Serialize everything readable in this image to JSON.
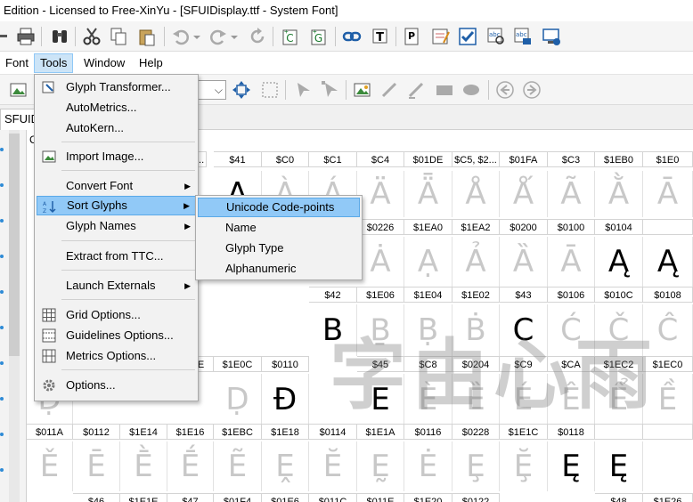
{
  "window": {
    "title": "Edition - Licensed to Free-XinYu - [SFUIDisplay.ttf - System Font]"
  },
  "menubar": {
    "items": [
      "Font",
      "Tools",
      "Window",
      "Help"
    ],
    "active": "Tools"
  },
  "document_tab": {
    "label": "SFUIDis"
  },
  "grid_partial_header": "C",
  "tools_menu": {
    "items": [
      {
        "label": "Glyph Transformer...",
        "icon": "glyph-transformer-icon"
      },
      {
        "label": "AutoMetrics..."
      },
      {
        "label": "AutoKern..."
      },
      {
        "label": "Import Image...",
        "icon": "image-icon"
      },
      {
        "label": "Convert Font",
        "submenu": true
      },
      {
        "label": "Sort Glyphs",
        "submenu": true,
        "icon": "sort-az-icon"
      },
      {
        "label": "Glyph Names",
        "submenu": true
      },
      {
        "label": "Extract from TTC..."
      },
      {
        "label": "Launch Externals",
        "submenu": true
      },
      {
        "label": "Grid Options...",
        "icon": "grid-icon"
      },
      {
        "label": "Guidelines Options...",
        "icon": "guidelines-icon"
      },
      {
        "label": "Metrics Options...",
        "icon": "metrics-icon"
      },
      {
        "label": "Options...",
        "icon": "gear-icon"
      }
    ],
    "highlighted": "Sort Glyphs"
  },
  "sort_glyphs_submenu": {
    "items": [
      "Unicode Code-points",
      "Name",
      "Glyph Type",
      "Alphanumeric"
    ],
    "highlighted": "Unicode Code-points"
  },
  "glyph_grid": {
    "rows": [
      {
        "labels": [
          "$C0",
          "$C1",
          "$C4",
          "$01DE",
          "$C5, $2...",
          "$01FA",
          "$C3",
          "$1EB0",
          "$1E0"
        ],
        "glyphs": [
          "À",
          "Á",
          "Ä",
          "Ǟ",
          "Å",
          "Ǻ",
          "Ã",
          "Ằ",
          "Ā"
        ]
      },
      {
        "labels": [
          "$0226",
          "$1EA0",
          "$1EA2",
          "$0200",
          "$0100",
          "$0104"
        ],
        "glyphs": [
          "Ȧ",
          "Ạ",
          "Ả",
          "Ȁ",
          "Ā",
          "Ą",
          "Ą"
        ]
      },
      {
        "labels": [
          "$42",
          "$1E06",
          "$1E04",
          "$1E02",
          "$43",
          "$0106",
          "$010C",
          "$0108"
        ],
        "glyphs": [
          "B",
          "Ḇ",
          "Ḅ",
          "Ḃ",
          "C",
          "Ć",
          "Č",
          "Ĉ"
        ]
      },
      {
        "labels": [
          "$1E0C",
          "$0110",
          "$45",
          "$C8",
          "$0204",
          "$C9",
          "$CA",
          "$1EC2",
          "$1EC0"
        ],
        "glyphs": [
          "Ḍ",
          "Đ",
          "E",
          "È",
          "Ȅ",
          "É",
          "Ê",
          "Ể",
          "Ề"
        ]
      },
      {
        "labels": [
          "$011A",
          "$0112",
          "$1E14",
          "$1E16",
          "$1EBC",
          "$1E18",
          "$0114",
          "$1E1A",
          "$0116",
          "$0228",
          "$1E1C",
          "$0118"
        ],
        "glyphs": [
          "Ě",
          "Ē",
          "Ḕ",
          "Ḗ",
          "Ẽ",
          "Ḙ",
          "Ĕ",
          "Ḛ",
          "Ė",
          "Ȩ",
          "Ḝ",
          "Ę",
          "Ę"
        ]
      },
      {
        "labels": [
          "$46",
          "$1E1E",
          "$47",
          "$01F4",
          "$01E6",
          "$011C",
          "$011E",
          "$1E20",
          "$0122",
          "$48",
          "$1E26"
        ]
      }
    ],
    "partial_labels": {
      "top_left": "$41",
      "top_tail": "0...",
      "row4_tail": "E"
    },
    "partial_glyphs": {
      "a_row": "A",
      "d_row": "Ḍ",
      "ecaron": "Ě"
    }
  },
  "watermark": {
    "text": "字由心雨"
  }
}
